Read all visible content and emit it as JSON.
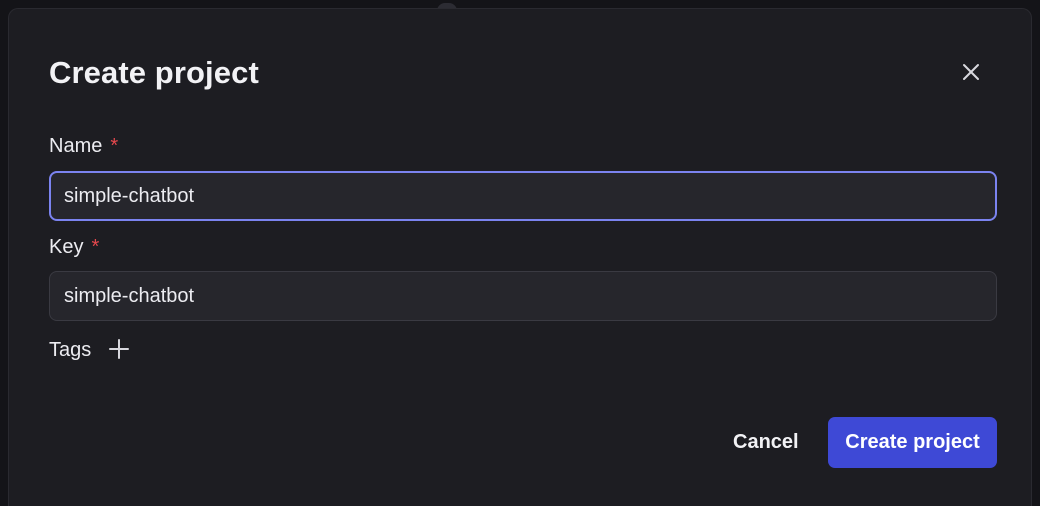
{
  "dialog": {
    "title": "Create project",
    "close_icon": "close-icon"
  },
  "form": {
    "name": {
      "label": "Name",
      "required_mark": "*",
      "value": "simple-chatbot"
    },
    "key": {
      "label": "Key",
      "required_mark": "*",
      "value": "simple-chatbot"
    },
    "tags": {
      "label": "Tags",
      "add_icon": "plus-icon"
    }
  },
  "actions": {
    "cancel_label": "Cancel",
    "create_label": "Create project"
  },
  "colors": {
    "accent": "#3e49d6",
    "focus_ring": "#7b83f0",
    "required": "#e5484d",
    "surface": "#1d1d22",
    "input_bg": "#26262c"
  }
}
